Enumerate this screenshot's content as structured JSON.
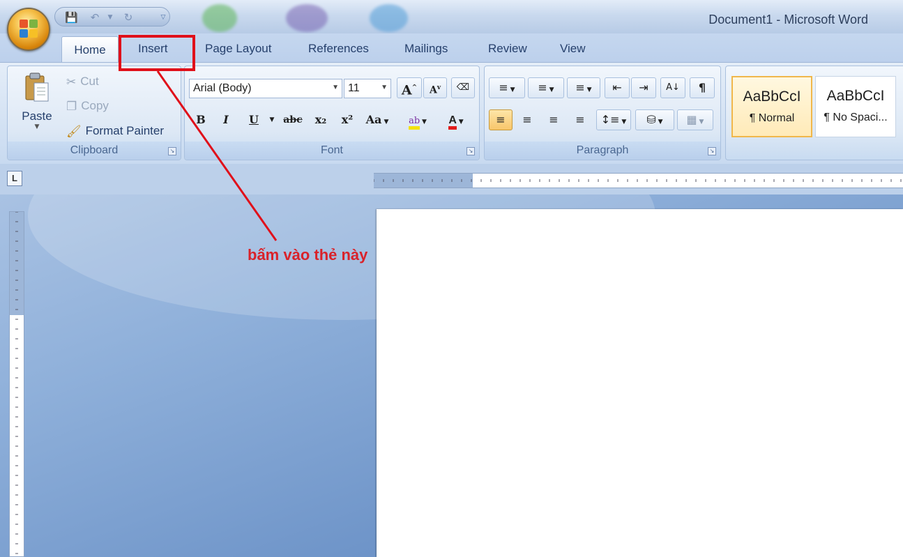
{
  "window": {
    "title": "Document1 - Microsoft Word"
  },
  "tabs": [
    "Home",
    "Insert",
    "Page Layout",
    "References",
    "Mailings",
    "Review",
    "View"
  ],
  "active_tab": "Home",
  "clipboard": {
    "paste_label": "Paste",
    "cut_label": "Cut",
    "copy_label": "Copy",
    "format_painter_label": "Format Painter",
    "group_label": "Clipboard"
  },
  "font": {
    "font_name": "Arial (Body)",
    "font_size": "11",
    "grow_label": "A",
    "shrink_label": "A",
    "bold_label": "B",
    "italic_label": "I",
    "underline_label": "U",
    "strike_label": "abc",
    "subscript_label": "x₂",
    "superscript_label": "x²",
    "case_label": "Aa",
    "highlight_label": "ab",
    "color_label": "A",
    "group_label": "Font"
  },
  "paragraph": {
    "group_label": "Paragraph",
    "pilcrow": "¶"
  },
  "styles": [
    {
      "sample": "AaBbCcI",
      "name": "¶ Normal"
    },
    {
      "sample": "AaBbCcI",
      "name": "¶ No Spaci..."
    }
  ],
  "annotation": {
    "text": "bấm vào thẻ này",
    "color": "#d9222a"
  },
  "colors": {
    "highlight_box": "#e0101a",
    "accent_text": "#26406c"
  }
}
